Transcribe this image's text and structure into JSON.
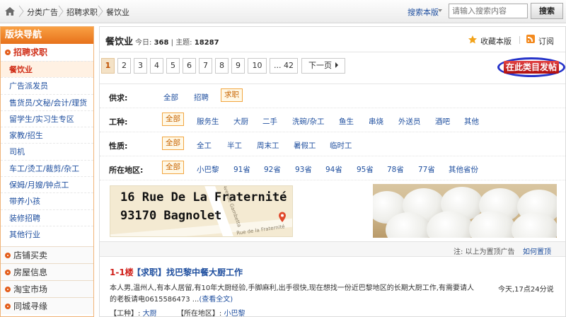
{
  "breadcrumb": {
    "items": [
      "分类广告",
      "招聘求职",
      "餐饮业"
    ]
  },
  "search": {
    "scope_label": "搜索本版",
    "placeholder": "请输入搜索内容",
    "button": "搜索"
  },
  "sidebar": {
    "title": "版块导航",
    "active_category": "招聘求职",
    "sub_items": [
      "餐饮业",
      "广告派发员",
      "售货员/文秘/会计/理货",
      "留学生/实习生专区",
      "家教/招生",
      "司机",
      "车工/烫工/裁剪/杂工",
      "保姆/月嫂/钟点工",
      "带养小孩",
      "装修招聘",
      "其他行业"
    ],
    "other_categories": [
      "店铺买卖",
      "房屋信息",
      "淘宝市场",
      "同城寻缘"
    ]
  },
  "board": {
    "title": "餐饮业",
    "today_label": "今日:",
    "today_count": "368",
    "topics_label": "主题:",
    "topics_count": "18287",
    "favorite": "收藏本版",
    "rss": "订阅"
  },
  "pager": {
    "pages": [
      "1",
      "2",
      "3",
      "4",
      "5",
      "6",
      "7",
      "8",
      "9",
      "10",
      "... 42"
    ],
    "next": "下一页",
    "current": "1"
  },
  "post_button": "在此类目发帖",
  "filters": {
    "supply": {
      "label": "供求:",
      "options": [
        "全部",
        "招聘",
        "求职"
      ],
      "selected": "求职"
    },
    "job_type": {
      "label": "工种:",
      "options": [
        "全部",
        "服务生",
        "大厨",
        "二手",
        "洗碗/杂工",
        "鱼生",
        "串烧",
        "外送员",
        "酒吧",
        "其他"
      ],
      "selected": "全部"
    },
    "nature": {
      "label": "性质:",
      "options": [
        "全部",
        "全工",
        "半工",
        "周末工",
        "暑假工",
        "临时工"
      ],
      "selected": "全部"
    },
    "region": {
      "label": "所在地区:",
      "options": [
        "全部",
        "小巴黎",
        "91省",
        "92省",
        "93省",
        "94省",
        "95省",
        "78省",
        "77省",
        "其他省份"
      ],
      "selected": "全部"
    }
  },
  "banner_ad": {
    "line1": "16 Rue De La Fraternité",
    "line2": "93170 Bagnolet",
    "map_label_1": "Avenue Gambetta",
    "map_label_2": "Rue de la Fraternité"
  },
  "ad_note": {
    "text": "注: 以上为置顶广告",
    "link": "如何置顶"
  },
  "listing": {
    "floor": "1-1楼",
    "title": "【求职】找巴黎中餐大厨工作",
    "body": "本人男,温州人,有本人居留,有10年大厨经验,手脚麻利,出手很快,现在想找一份近巴黎地区的长期大厨工作,有需要请人的老板请电0615586473 ...",
    "view_all": "(查看全文)",
    "time": "今天,17点24分说",
    "type_label": "【工种】:",
    "type_value": "大厨",
    "region_label": "【所在地区】:",
    "region_value": "小巴黎"
  },
  "colors": {
    "accent_orange": "#e7711b",
    "link_blue": "#1f4f9f",
    "post_red": "#c01818",
    "highlight_ring": "#2533c9"
  }
}
